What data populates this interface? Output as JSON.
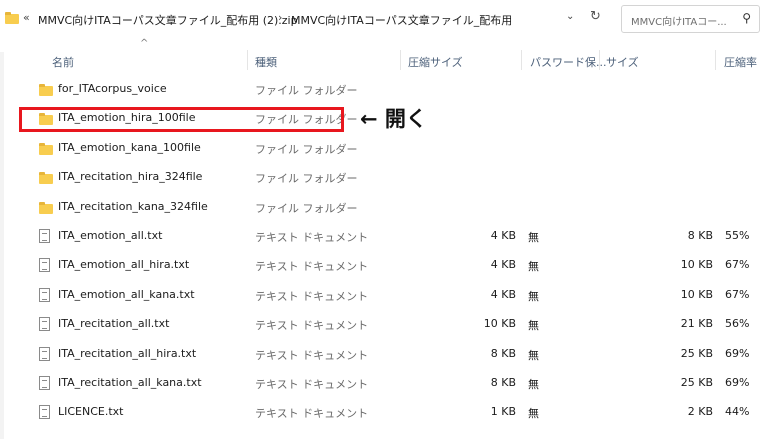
{
  "breadcrumb": {
    "overflow": "«",
    "parts": [
      "MMVC向けITAコーパス文章ファイル_配布用 (2).zip",
      "MMVC向けITAコーパス文章ファイル_配布用"
    ],
    "separator": "›",
    "dropdown": "⌄",
    "refresh": "↻"
  },
  "search": {
    "placeholder": "MMVC向けITAコー...",
    "icon": "search-icon"
  },
  "columns": {
    "sort_indicator": "^",
    "name": "名前",
    "type": "種類",
    "compressed_size": "圧縮サイズ",
    "password": "パスワード保...",
    "size": "サイズ",
    "ratio": "圧縮率"
  },
  "files": [
    {
      "icon": "folder",
      "name": "for_ITAcorpus_voice",
      "type": "ファイル フォルダー",
      "compressed_size": "",
      "password": "",
      "size": "",
      "ratio": ""
    },
    {
      "icon": "folder",
      "name": "ITA_emotion_hira_100file",
      "type": "ファイル フォルダー",
      "compressed_size": "",
      "password": "",
      "size": "",
      "ratio": ""
    },
    {
      "icon": "folder",
      "name": "ITA_emotion_kana_100file",
      "type": "ファイル フォルダー",
      "compressed_size": "",
      "password": "",
      "size": "",
      "ratio": ""
    },
    {
      "icon": "folder",
      "name": "ITA_recitation_hira_324file",
      "type": "ファイル フォルダー",
      "compressed_size": "",
      "password": "",
      "size": "",
      "ratio": ""
    },
    {
      "icon": "folder",
      "name": "ITA_recitation_kana_324file",
      "type": "ファイル フォルダー",
      "compressed_size": "",
      "password": "",
      "size": "",
      "ratio": ""
    },
    {
      "icon": "file",
      "name": "ITA_emotion_all.txt",
      "type": "テキスト ドキュメント",
      "compressed_size": "4 KB",
      "password": "無",
      "size": "8 KB",
      "ratio": "55%"
    },
    {
      "icon": "file",
      "name": "ITA_emotion_all_hira.txt",
      "type": "テキスト ドキュメント",
      "compressed_size": "4 KB",
      "password": "無",
      "size": "10 KB",
      "ratio": "67%"
    },
    {
      "icon": "file",
      "name": "ITA_emotion_all_kana.txt",
      "type": "テキスト ドキュメント",
      "compressed_size": "4 KB",
      "password": "無",
      "size": "10 KB",
      "ratio": "67%"
    },
    {
      "icon": "file",
      "name": "ITA_recitation_all.txt",
      "type": "テキスト ドキュメント",
      "compressed_size": "10 KB",
      "password": "無",
      "size": "21 KB",
      "ratio": "56%"
    },
    {
      "icon": "file",
      "name": "ITA_recitation_all_hira.txt",
      "type": "テキスト ドキュメント",
      "compressed_size": "8 KB",
      "password": "無",
      "size": "25 KB",
      "ratio": "69%"
    },
    {
      "icon": "file",
      "name": "ITA_recitation_all_kana.txt",
      "type": "テキスト ドキュメント",
      "compressed_size": "8 KB",
      "password": "無",
      "size": "25 KB",
      "ratio": "69%"
    },
    {
      "icon": "file",
      "name": "LICENCE.txt",
      "type": "テキスト ドキュメント",
      "compressed_size": "1 KB",
      "password": "無",
      "size": "2 KB",
      "ratio": "44%"
    }
  ],
  "annotation": {
    "text": "← 開く",
    "highlight_color": "#e8171e"
  },
  "colors": {
    "folder": "#f8cd4f",
    "header_text": "#4c607a"
  }
}
